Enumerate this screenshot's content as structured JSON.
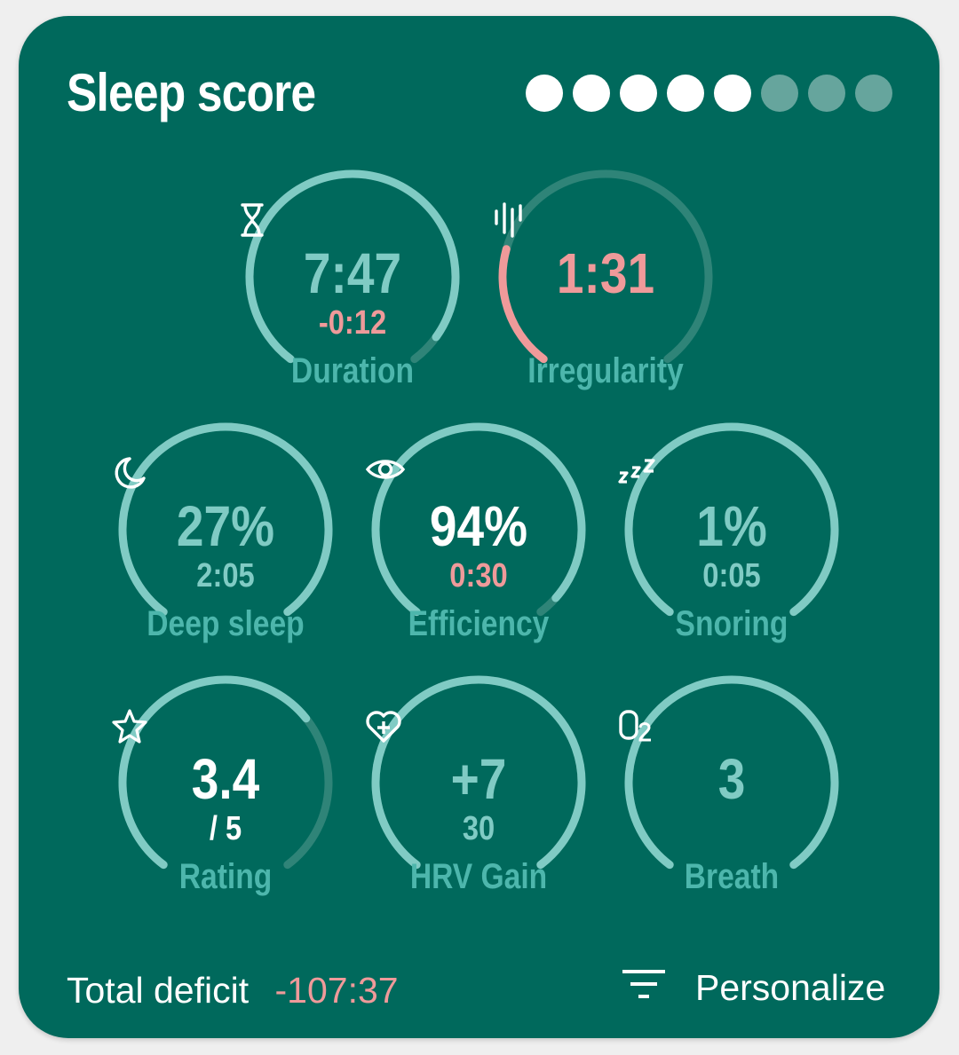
{
  "card": {
    "title": "Sleep score",
    "dots": {
      "filled": 5,
      "total": 8
    },
    "colors": {
      "background": "#00695c",
      "arc": "#80cbc4",
      "arc_track": "#2f8478",
      "alert": "#ef9a9a",
      "label": "#4db6ac",
      "white": "#ffffff"
    }
  },
  "gauges": [
    {
      "id": "duration",
      "icon": "hourglass-icon",
      "value": "7:47",
      "sub": "-0:12",
      "label": "Duration",
      "fill": 0.94,
      "arc_color": "teal",
      "value_color": "teal",
      "sub_color": "alert"
    },
    {
      "id": "irregularity",
      "icon": "irregularity-bars-icon",
      "value": "1:31",
      "sub": "",
      "label": "Irregularity",
      "fill": 0.24,
      "arc_color": "alert",
      "value_color": "alert",
      "sub_color": "teal"
    },
    {
      "id": "deep-sleep",
      "icon": "moon-icon",
      "value": "27%",
      "sub": "2:05",
      "label": "Deep sleep",
      "fill": 1.0,
      "arc_color": "teal",
      "value_color": "teal",
      "sub_color": "teal"
    },
    {
      "id": "efficiency",
      "icon": "eye-icon",
      "value": "94%",
      "sub": "0:30",
      "label": "Efficiency",
      "fill": 0.96,
      "arc_color": "teal",
      "value_color": "white",
      "sub_color": "alert"
    },
    {
      "id": "snoring",
      "icon": "snore-zzz-icon",
      "value": "1%",
      "sub": "0:05",
      "label": "Snoring",
      "fill": 1.0,
      "arc_color": "teal",
      "value_color": "teal",
      "sub_color": "teal"
    },
    {
      "id": "rating",
      "icon": "star-icon",
      "value": "3.4",
      "sub": "/ 5",
      "label": "Rating",
      "fill": 0.68,
      "arc_color": "teal",
      "value_color": "white",
      "sub_color": "white"
    },
    {
      "id": "hrv-gain",
      "icon": "heart-plus-icon",
      "value": "+7",
      "sub": "30",
      "label": "HRV Gain",
      "fill": 1.0,
      "arc_color": "teal",
      "value_color": "teal",
      "sub_color": "teal"
    },
    {
      "id": "breath",
      "icon": "o2-icon",
      "value": "3",
      "sub": "",
      "label": "Breath",
      "fill": 1.0,
      "arc_color": "teal",
      "value_color": "teal",
      "sub_color": "teal"
    }
  ],
  "footer": {
    "deficit_label": "Total deficit",
    "deficit_value": "-107:37",
    "personalize_label": "Personalize",
    "personalize_icon": "filter-icon"
  }
}
